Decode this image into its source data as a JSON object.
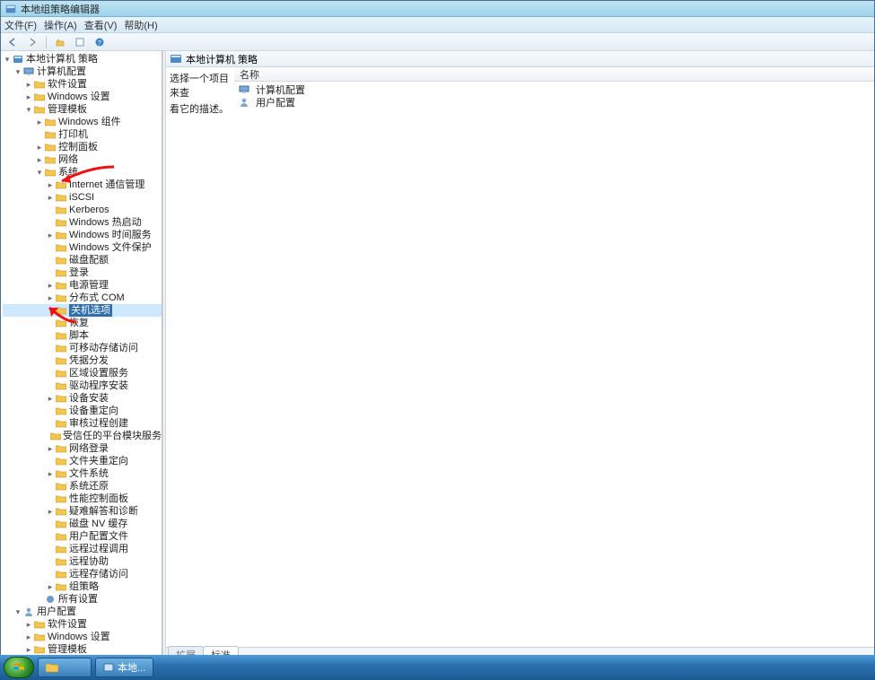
{
  "window": {
    "title": "本地组策略编辑器"
  },
  "menu": {
    "file": "文件(F)",
    "action": "操作(A)",
    "view": "查看(V)",
    "help": "帮助(H)"
  },
  "tree": {
    "root": "本地计算机 策略",
    "computer_config": "计算机配置",
    "software_settings": "软件设置",
    "windows_settings": "Windows 设置",
    "admin_templates": "管理模板",
    "windows_components": "Windows 组件",
    "printers": "打印机",
    "control_panel": "控制面板",
    "network": "网络",
    "system": "系统",
    "internet_comm_mgmt": "Internet 通信管理",
    "iscsi": "iSCSI",
    "kerberos": "Kerberos",
    "windows_hotstart": "Windows 热启动",
    "windows_time_service": "Windows 时间服务",
    "windows_file_protection": "Windows 文件保护",
    "disk_quotas": "磁盘配额",
    "logon": "登录",
    "power_management": "电源管理",
    "distributed_com": "分布式 COM",
    "shutdown_options": "关机选项",
    "recovery": "恢复",
    "scripts": "脚本",
    "removable_storage_access": "可移动存储访问",
    "credential_delegation": "凭据分发",
    "locale_services": "区域设置服务",
    "driver_installation": "驱动程序安装",
    "device_installation": "设备安装",
    "device_redirection": "设备重定向",
    "audit_process_creation": "审核过程创建",
    "trusted_platform_module": "受信任的平台模块服务",
    "net_logon": "网络登录",
    "folder_redirection": "文件夹重定向",
    "filesystem": "文件系统",
    "system_restore": "系统还原",
    "performance_control_panel": "性能控制面板",
    "troubleshooting_diag": "疑难解答和诊断",
    "disk_nv_cache": "磁盘 NV 缓存",
    "user_profiles": "用户配置文件",
    "remote_procedure_call": "远程过程调用",
    "remote_assistance": "远程协助",
    "remote_storage_access": "远程存储访问",
    "group_policy": "组策略",
    "all_settings": "所有设置",
    "user_config": "用户配置",
    "software_settings2": "软件设置",
    "windows_settings2": "Windows 设置",
    "admin_templates2": "管理模板"
  },
  "right": {
    "header": "本地计算机 策略",
    "prompt_line1": "选择一个项目来查",
    "prompt_line2": "看它的描述。",
    "col_name": "名称",
    "item_computer": "计算机配置",
    "item_user": "用户配置",
    "tab_extended": "扩展",
    "tab_standard": "标准"
  },
  "taskbar": {
    "app": "本地..."
  }
}
